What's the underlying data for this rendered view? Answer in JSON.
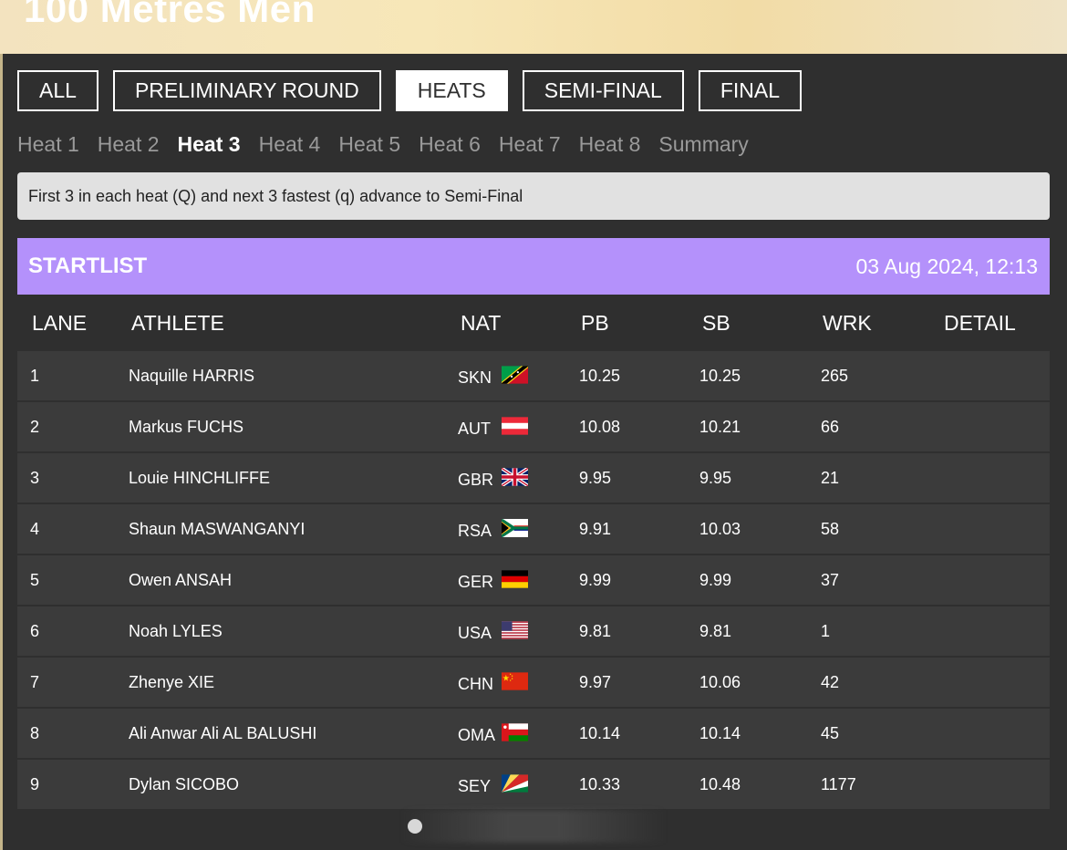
{
  "page": {
    "title": "100 Metres Men"
  },
  "round_tabs": [
    {
      "label": "ALL",
      "active": false
    },
    {
      "label": "PRELIMINARY ROUND",
      "active": false
    },
    {
      "label": "HEATS",
      "active": true
    },
    {
      "label": "SEMI-FINAL",
      "active": false
    },
    {
      "label": "FINAL",
      "active": false
    }
  ],
  "heat_tabs": [
    {
      "label": "Heat 1",
      "active": false
    },
    {
      "label": "Heat 2",
      "active": false
    },
    {
      "label": "Heat 3",
      "active": true
    },
    {
      "label": "Heat 4",
      "active": false
    },
    {
      "label": "Heat 5",
      "active": false
    },
    {
      "label": "Heat 6",
      "active": false
    },
    {
      "label": "Heat 7",
      "active": false
    },
    {
      "label": "Heat 8",
      "active": false
    },
    {
      "label": "Summary",
      "active": false
    }
  ],
  "notice": "First 3 in each heat (Q) and next 3 fastest (q) advance to Semi-Final",
  "startlist": {
    "label": "STARTLIST",
    "datetime": "03 Aug 2024, 12:13"
  },
  "table": {
    "headers": {
      "lane": "LANE",
      "athlete": "ATHLETE",
      "nat": "NAT",
      "pb": "PB",
      "sb": "SB",
      "wrk": "WRK",
      "detail": "DETAIL"
    },
    "rows": [
      {
        "lane": "1",
        "athlete": "Naquille HARRIS",
        "nat": "SKN",
        "flag": "skn-flag-icon",
        "pb": "10.25",
        "sb": "10.25",
        "wrk": "265"
      },
      {
        "lane": "2",
        "athlete": "Markus FUCHS",
        "nat": "AUT",
        "flag": "aut-flag-icon",
        "pb": "10.08",
        "sb": "10.21",
        "wrk": "66"
      },
      {
        "lane": "3",
        "athlete": "Louie HINCHLIFFE",
        "nat": "GBR",
        "flag": "gbr-flag-icon",
        "pb": "9.95",
        "sb": "9.95",
        "wrk": "21"
      },
      {
        "lane": "4",
        "athlete": "Shaun MASWANGANYI",
        "nat": "RSA",
        "flag": "rsa-flag-icon",
        "pb": "9.91",
        "sb": "10.03",
        "wrk": "58"
      },
      {
        "lane": "5",
        "athlete": "Owen ANSAH",
        "nat": "GER",
        "flag": "ger-flag-icon",
        "pb": "9.99",
        "sb": "9.99",
        "wrk": "37"
      },
      {
        "lane": "6",
        "athlete": "Noah LYLES",
        "nat": "USA",
        "flag": "usa-flag-icon",
        "pb": "9.81",
        "sb": "9.81",
        "wrk": "1"
      },
      {
        "lane": "7",
        "athlete": "Zhenye XIE",
        "nat": "CHN",
        "flag": "chn-flag-icon",
        "pb": "9.97",
        "sb": "10.06",
        "wrk": "42"
      },
      {
        "lane": "8",
        "athlete": "Ali Anwar Ali AL BALUSHI",
        "nat": "OMA",
        "flag": "oma-flag-icon",
        "pb": "10.14",
        "sb": "10.14",
        "wrk": "45"
      },
      {
        "lane": "9",
        "athlete": "Dylan SICOBO",
        "nat": "SEY",
        "flag": "sey-flag-icon",
        "pb": "10.33",
        "sb": "10.48",
        "wrk": "1177"
      }
    ]
  },
  "colors": {
    "accent": "#b491fb",
    "background": "#2f2f2f",
    "row": "#3b3b3b",
    "notice": "#e1e1e1"
  }
}
